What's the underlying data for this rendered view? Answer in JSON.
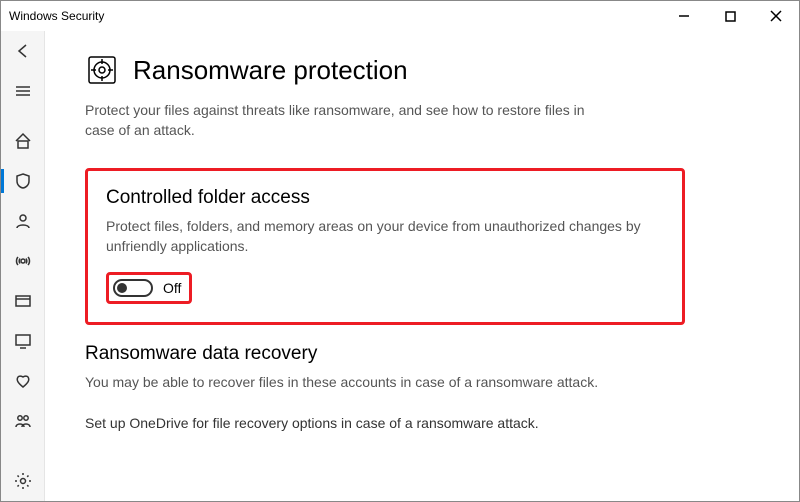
{
  "window": {
    "title": "Windows Security"
  },
  "sidebar": {
    "back": "back-icon",
    "menu": "menu-icon",
    "items": [
      {
        "name": "home-icon"
      },
      {
        "name": "shield-icon"
      },
      {
        "name": "account-icon"
      },
      {
        "name": "firewall-icon"
      },
      {
        "name": "app-control-icon"
      },
      {
        "name": "device-security-icon"
      },
      {
        "name": "health-icon"
      },
      {
        "name": "family-icon"
      }
    ],
    "settings": "settings-icon"
  },
  "page": {
    "icon": "ransomware-shield-icon",
    "title": "Ransomware protection",
    "lead": "Protect your files against threats like ransomware, and see how to restore files in case of an attack."
  },
  "cfa": {
    "heading": "Controlled folder access",
    "desc": "Protect files, folders, and memory areas on your device from unauthorized changes by unfriendly applications.",
    "toggle_state": "Off"
  },
  "recovery": {
    "heading": "Ransomware data recovery",
    "desc": "You may be able to recover files in these accounts in case of a ransomware attack."
  },
  "onedrive": {
    "text": "Set up OneDrive for file recovery options in case of a ransomware attack."
  }
}
